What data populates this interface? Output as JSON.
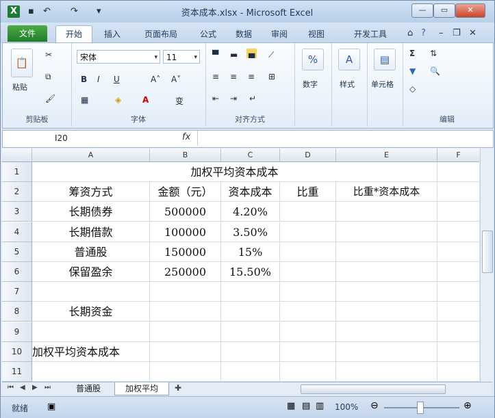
{
  "window": {
    "title": "资本成本.xlsx - Microsoft Excel"
  },
  "ribbon_tabs": [
    "文件",
    "开始",
    "插入",
    "页面布局",
    "公式",
    "数据",
    "审阅",
    "视图",
    "开发工具"
  ],
  "ribbon": {
    "clipboard": {
      "paste": "粘贴",
      "label": "剪贴板"
    },
    "font": {
      "name": "宋体",
      "size": "11",
      "bold": "B",
      "italic": "I",
      "underline": "U",
      "grow": "A˄",
      "shrink": "A˅",
      "label": "字体"
    },
    "alignment": {
      "label": "对齐方式"
    },
    "number": {
      "button": "数字",
      "symbol": "%"
    },
    "styles": {
      "button": "样式"
    },
    "cells": {
      "button": "单元格"
    },
    "editing": {
      "label": "编辑",
      "sum": "Σ"
    }
  },
  "formula_bar": {
    "name_box": "I20",
    "fx": "fx",
    "content": ""
  },
  "columns": [
    "A",
    "B",
    "C",
    "D",
    "E",
    "F"
  ],
  "rows": [
    {
      "n": "1",
      "cells": [
        "加权平均资本成本",
        "",
        "",
        "",
        "",
        ""
      ]
    },
    {
      "n": "2",
      "cells": [
        "筹资方式",
        "金额（元）",
        "资本成本",
        "比重",
        "比重*资本成本",
        ""
      ]
    },
    {
      "n": "3",
      "cells": [
        "长期债券",
        "500000",
        "4.20%",
        "",
        "",
        ""
      ]
    },
    {
      "n": "4",
      "cells": [
        "长期借款",
        "100000",
        "3.50%",
        "",
        "",
        ""
      ]
    },
    {
      "n": "5",
      "cells": [
        "普通股",
        "150000",
        "15%",
        "",
        "",
        ""
      ]
    },
    {
      "n": "6",
      "cells": [
        "保留盈余",
        "250000",
        "15.50%",
        "",
        "",
        ""
      ]
    },
    {
      "n": "7",
      "cells": [
        "",
        "",
        "",
        "",
        "",
        ""
      ]
    },
    {
      "n": "8",
      "cells": [
        "长期资金",
        "",
        "",
        "",
        "",
        ""
      ]
    },
    {
      "n": "9",
      "cells": [
        "",
        "",
        "",
        "",
        "",
        ""
      ]
    },
    {
      "n": "10",
      "cells": [
        "加权平均资本成本",
        "",
        "",
        "",
        "",
        ""
      ]
    },
    {
      "n": "11",
      "cells": [
        "",
        "",
        "",
        "",
        "",
        ""
      ]
    }
  ],
  "sheet_tabs": [
    "普通股",
    "加权平均"
  ],
  "status": {
    "ready": "就绪",
    "zoom": "100%"
  }
}
